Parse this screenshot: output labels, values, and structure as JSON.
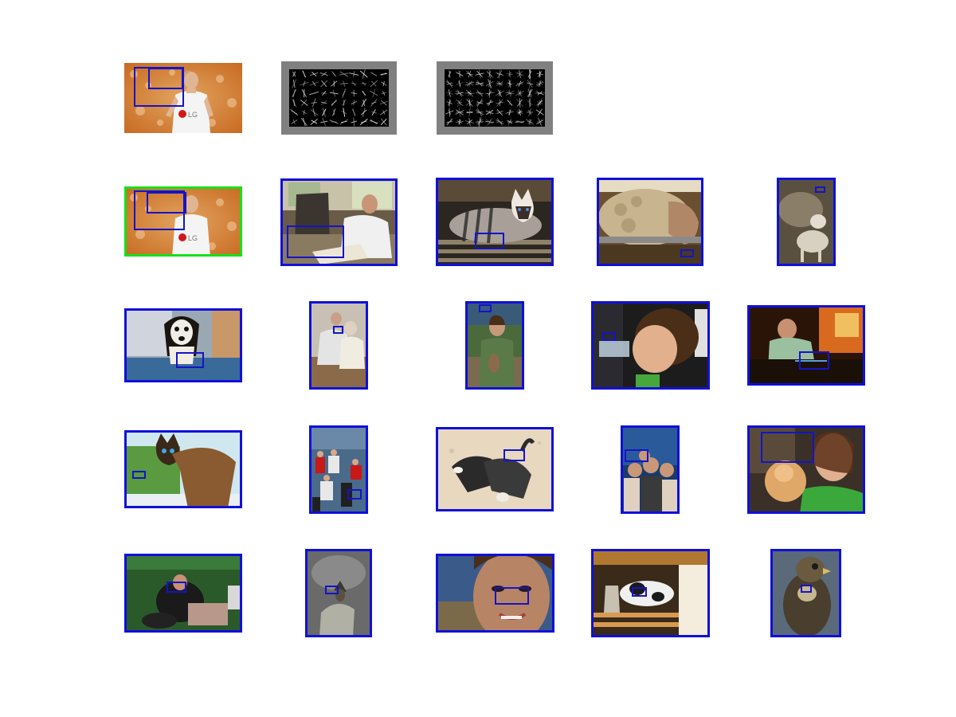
{
  "figure": {
    "rows": [
      {
        "name": "query-row",
        "items": [
          {
            "kind": "photo",
            "name": "query-image-football-player",
            "scene": "football-player",
            "frame": "none"
          },
          {
            "kind": "hog",
            "name": "hog-template-positive"
          },
          {
            "kind": "hog",
            "name": "hog-template-weights"
          }
        ]
      },
      {
        "name": "results-row-1",
        "items": [
          {
            "kind": "photo",
            "name": "result-football-player",
            "scene": "football-player",
            "frame": "green"
          },
          {
            "kind": "photo",
            "name": "result-man-on-couch",
            "scene": "man-couch",
            "frame": "blue"
          },
          {
            "kind": "photo",
            "name": "result-siamese-cat",
            "scene": "siamese-cat",
            "frame": "blue"
          },
          {
            "kind": "photo",
            "name": "result-sheep",
            "scene": "sheep",
            "frame": "blue"
          },
          {
            "kind": "photo",
            "name": "result-sheep-lamb",
            "scene": "lamb",
            "frame": "blue"
          }
        ]
      },
      {
        "name": "results-row-2",
        "items": [
          {
            "kind": "photo",
            "name": "result-beagle",
            "scene": "beagle",
            "frame": "blue"
          },
          {
            "kind": "photo",
            "name": "result-elderly-couple",
            "scene": "couple",
            "frame": "blue"
          },
          {
            "kind": "photo",
            "name": "result-woman-with-bird",
            "scene": "woman-bird",
            "frame": "blue"
          },
          {
            "kind": "photo",
            "name": "result-boy-drinking",
            "scene": "boy-drinking",
            "frame": "blue"
          },
          {
            "kind": "photo",
            "name": "result-man-at-stove",
            "scene": "man-stove",
            "frame": "blue"
          }
        ]
      },
      {
        "name": "results-row-3",
        "items": [
          {
            "kind": "photo",
            "name": "result-siamese-cat-window",
            "scene": "cat-window",
            "frame": "blue"
          },
          {
            "kind": "photo",
            "name": "result-crowd-boat",
            "scene": "crowd",
            "frame": "blue"
          },
          {
            "kind": "photo",
            "name": "result-running-dogs",
            "scene": "dogs-running",
            "frame": "blue"
          },
          {
            "kind": "photo",
            "name": "result-group-friends",
            "scene": "friends",
            "frame": "blue"
          },
          {
            "kind": "photo",
            "name": "result-woman-with-pomeranian",
            "scene": "woman-dog",
            "frame": "blue"
          }
        ]
      },
      {
        "name": "results-row-4",
        "items": [
          {
            "kind": "photo",
            "name": "result-green-room",
            "scene": "green-room",
            "frame": "blue"
          },
          {
            "kind": "photo",
            "name": "result-bird-on-rock",
            "scene": "bird-rock",
            "frame": "blue"
          },
          {
            "kind": "photo",
            "name": "result-woman-face",
            "scene": "face",
            "frame": "blue"
          },
          {
            "kind": "photo",
            "name": "result-cat-on-shelf",
            "scene": "cat-shelf",
            "frame": "blue"
          },
          {
            "kind": "photo",
            "name": "result-falcon",
            "scene": "falcon",
            "frame": "blue"
          }
        ]
      }
    ],
    "colors": {
      "result_frame": "#1010d8",
      "query_frame": "#18e018",
      "detection_box": "#1414c8",
      "hog_border": "#808080"
    }
  }
}
